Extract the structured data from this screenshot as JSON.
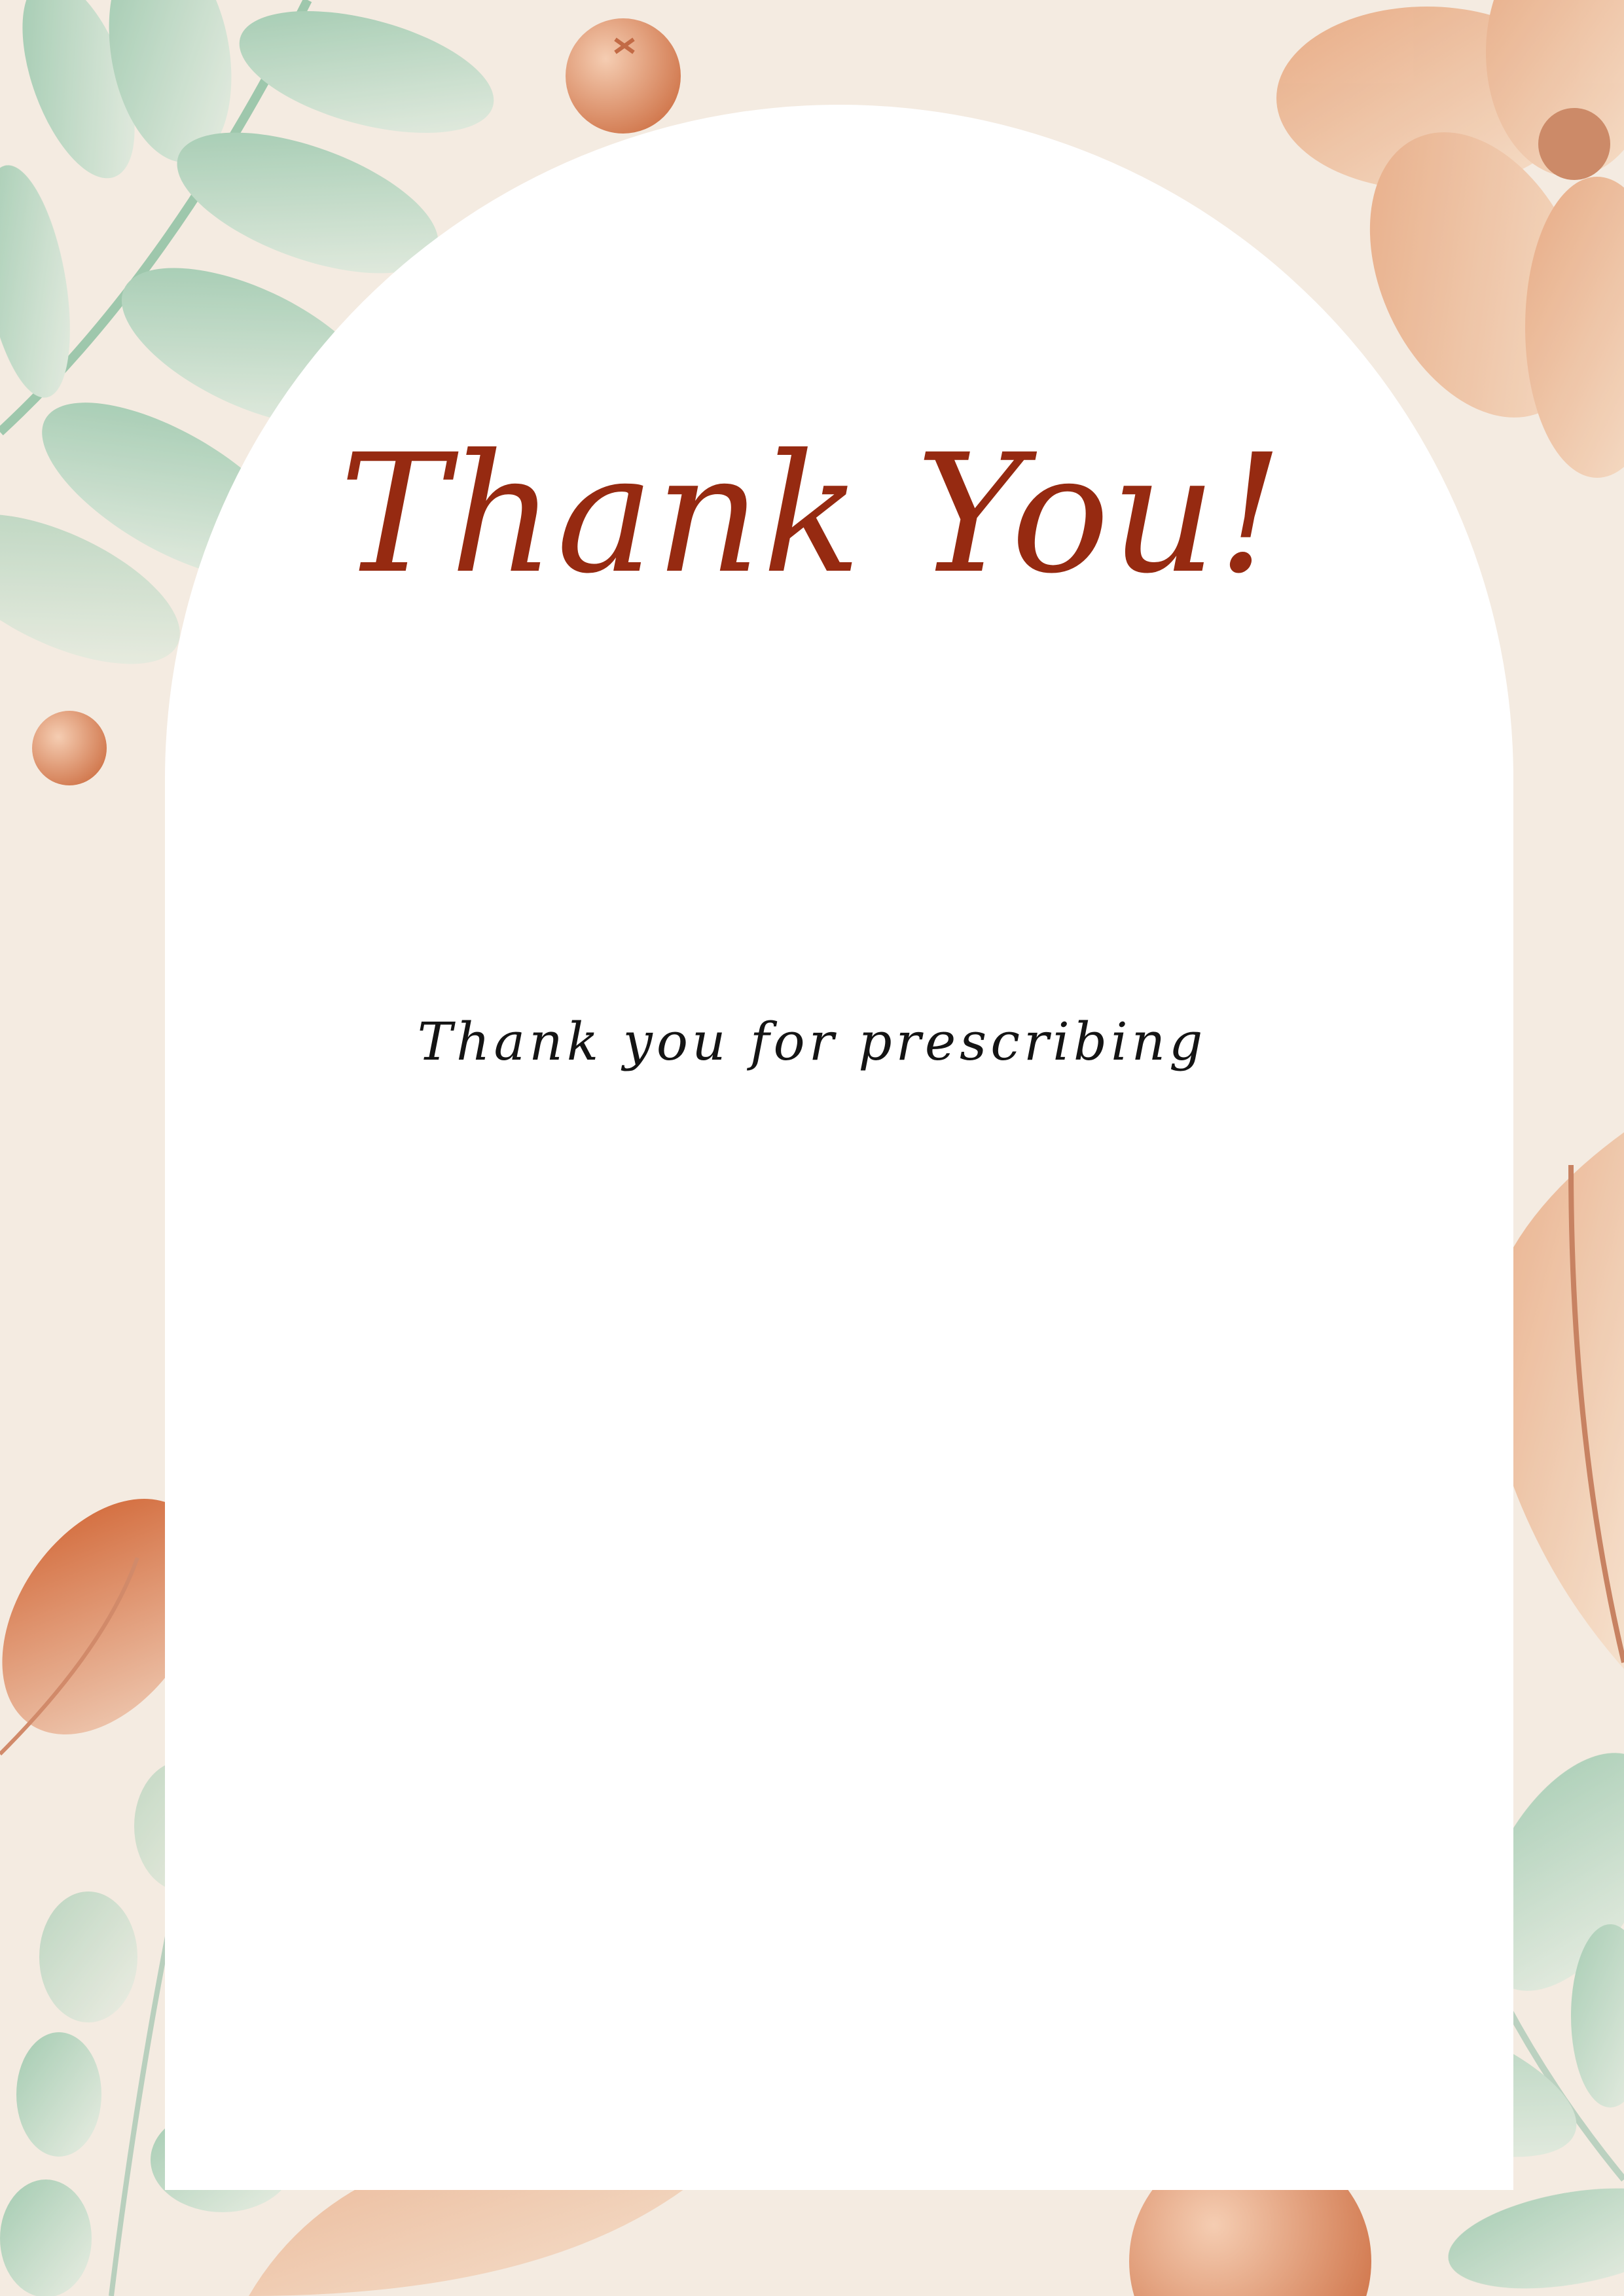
{
  "card": {
    "title": "Thank You!",
    "message": "Thank you for prescribing"
  },
  "colors": {
    "background": "#f4ebe1",
    "panel": "#ffffff",
    "title": "#962a11",
    "message": "#141414",
    "leaf_green": "#9fc9b0",
    "leaf_peach": "#e9b48f",
    "berry": "#d98a62"
  },
  "decorations": [
    "green-leaf-branch-icon",
    "peach-flower-icon",
    "orange-berry-icon",
    "autumn-leaf-icon",
    "eucalyptus-sprig-icon"
  ]
}
